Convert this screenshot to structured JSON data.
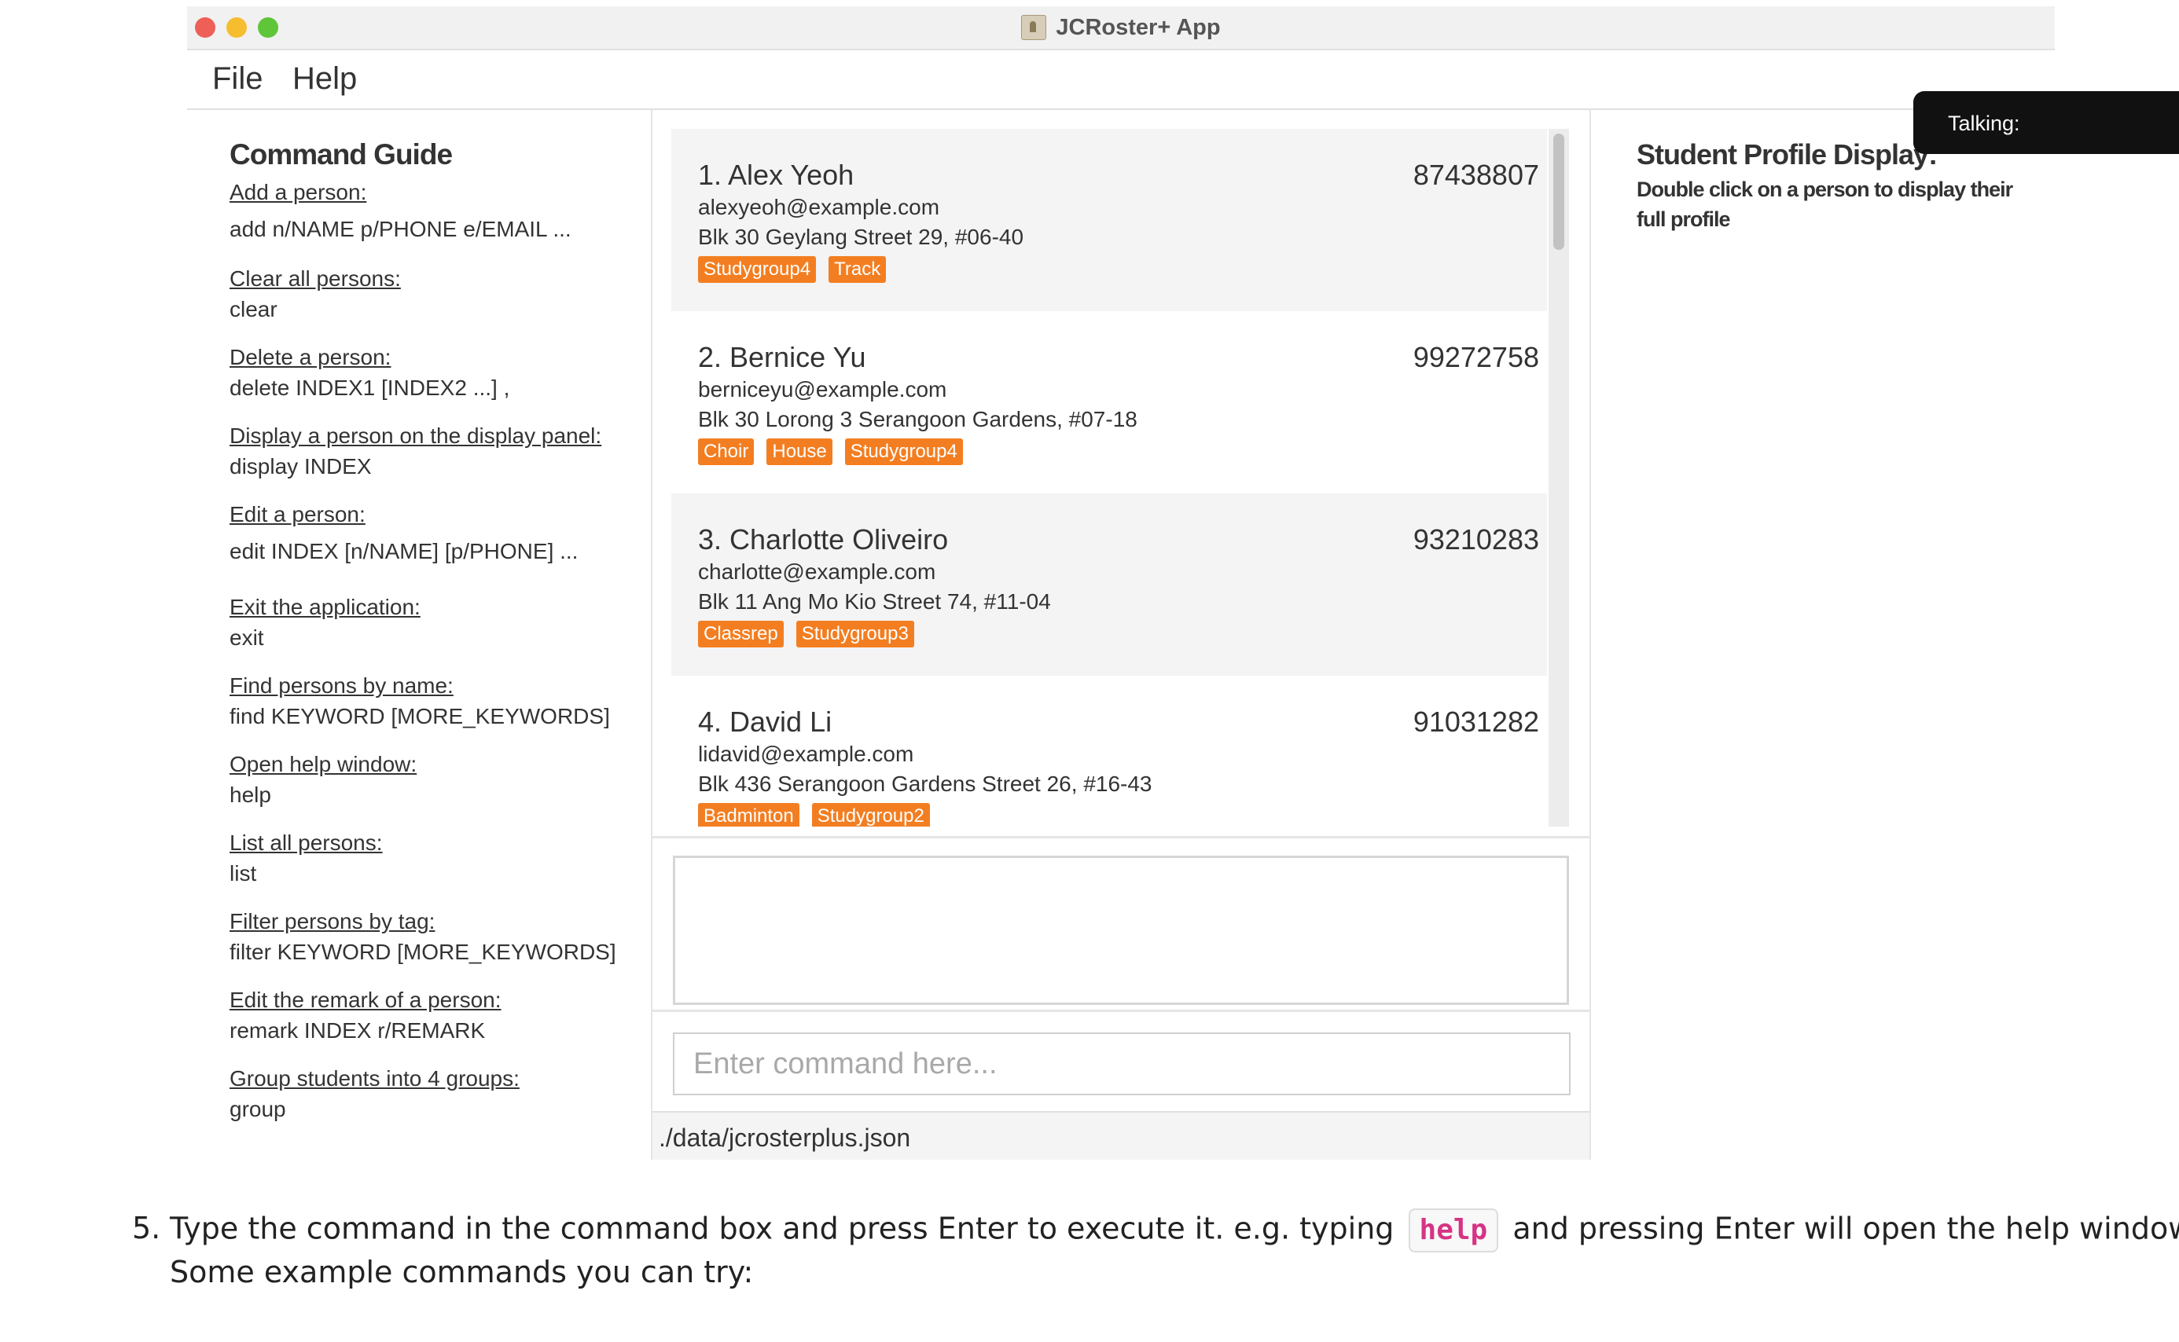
{
  "window": {
    "title": "JCRoster+ App",
    "app_icon": "app-icon"
  },
  "menu": {
    "file": "File",
    "help": "Help"
  },
  "guide": {
    "title": "Command Guide",
    "items": [
      {
        "head": "Add a person:",
        "cmd": "add n/NAME p/PHONE e/EMAIL ..."
      },
      {
        "head": "Clear all persons:",
        "cmd": "clear"
      },
      {
        "head": "Delete a person:",
        "cmd": "delete INDEX1 [INDEX2 ...] ,"
      },
      {
        "head": "Display a person on the display panel:",
        "cmd": "display INDEX"
      },
      {
        "head": "Edit a person:",
        "cmd": "edit INDEX [n/NAME] [p/PHONE] ..."
      },
      {
        "head": "Exit the application:",
        "cmd": "exit"
      },
      {
        "head": "Find persons by name:",
        "cmd": "find KEYWORD [MORE_KEYWORDS]"
      },
      {
        "head": "Open help window:",
        "cmd": "help"
      },
      {
        "head": "List all persons:",
        "cmd": "list"
      },
      {
        "head": "Filter persons by tag:",
        "cmd": "filter KEYWORD [MORE_KEYWORDS]"
      },
      {
        "head": "Edit the remark of a person:",
        "cmd": "remark INDEX r/REMARK"
      },
      {
        "head": "Group students into 4 groups:",
        "cmd": "group"
      }
    ]
  },
  "persons": [
    {
      "name": "1. Alex Yeoh",
      "phone": "87438807",
      "email": "alexyeoh@example.com",
      "address": "Blk 30 Geylang Street 29, #06-40",
      "tags": [
        "Studygroup4",
        "Track"
      ]
    },
    {
      "name": "2. Bernice Yu",
      "phone": "99272758",
      "email": "berniceyu@example.com",
      "address": "Blk 30 Lorong 3 Serangoon Gardens, #07-18",
      "tags": [
        "Choir",
        "House",
        "Studygroup4"
      ]
    },
    {
      "name": "3. Charlotte Oliveiro",
      "phone": "93210283",
      "email": "charlotte@example.com",
      "address": "Blk 11 Ang Mo Kio Street 74, #11-04",
      "tags": [
        "Classrep",
        "Studygroup3"
      ]
    },
    {
      "name": "4. David Li",
      "phone": "91031282",
      "email": "lidavid@example.com",
      "address": "Blk 436 Serangoon Gardens Street 26, #16-43",
      "tags": [
        "Badminton",
        "Studygroup2"
      ]
    }
  ],
  "command": {
    "placeholder": "Enter command here...",
    "value": "",
    "result": ""
  },
  "status": {
    "path": "./data/jcrosterplus.json"
  },
  "profile": {
    "title": "Student Profile Display:",
    "hint": "Double click on a person to display their full profile"
  },
  "overlay": {
    "talking": "Talking:"
  },
  "doc": {
    "number": "5.",
    "line1_before": "Type the command in the command box and press Enter to execute it. e.g. typing",
    "code": "help",
    "line1_after": "and pressing Enter will open the help window.",
    "line2": "Some example commands you can try:"
  },
  "colors": {
    "tag": "#f37e21",
    "card_alt": "#f4f4f4",
    "code": "#d63384"
  }
}
